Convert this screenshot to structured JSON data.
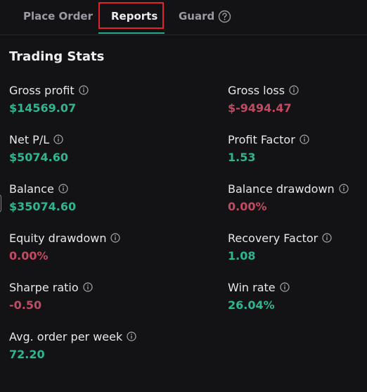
{
  "tabs": [
    {
      "label": "Place Order"
    },
    {
      "label": "Reports"
    },
    {
      "label": "Guard"
    }
  ],
  "section_title": "Trading Stats",
  "colors": {
    "positive": "#2fb58f",
    "negative": "#c24a63",
    "accent": "#22a98a",
    "highlight_outline": "#e2222a"
  },
  "stats": {
    "gross_profit": {
      "label": "Gross profit",
      "value": "$14569.07",
      "tone": "positive",
      "icon": "info-icon"
    },
    "gross_loss": {
      "label": "Gross loss",
      "value": "$-9494.47",
      "tone": "negative",
      "icon": "info-icon"
    },
    "net_pl": {
      "label": "Net P/L",
      "value": "$5074.60",
      "tone": "positive",
      "icon": "info-icon"
    },
    "profit_factor": {
      "label": "Profit Factor",
      "value": "1.53",
      "tone": "positive",
      "icon": "info-icon"
    },
    "balance": {
      "label": "Balance",
      "value": "$35074.60",
      "tone": "positive",
      "icon": "info-icon"
    },
    "balance_drawdown": {
      "label": "Balance drawdown",
      "value": "0.00%",
      "tone": "negative",
      "icon": "info-icon"
    },
    "equity_drawdown": {
      "label": "Equity drawdown",
      "value": "0.00%",
      "tone": "negative",
      "icon": "info-icon"
    },
    "recovery_factor": {
      "label": "Recovery Factor",
      "value": "1.08",
      "tone": "positive",
      "icon": "info-icon"
    },
    "sharpe_ratio": {
      "label": "Sharpe ratio",
      "value": "-0.50",
      "tone": "negative",
      "icon": "info-icon"
    },
    "win_rate": {
      "label": "Win rate",
      "value": "26.04%",
      "tone": "positive",
      "icon": "info-icon"
    },
    "avg_order_per_week": {
      "label": "Avg. order per week",
      "value": "72.20",
      "tone": "positive",
      "icon": "info-icon"
    }
  }
}
